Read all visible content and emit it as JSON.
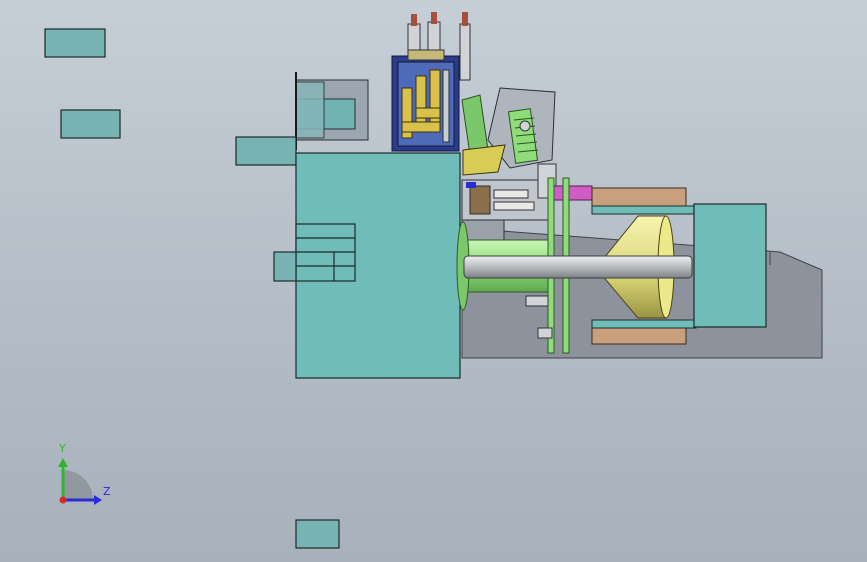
{
  "triad": {
    "y_label": "Y",
    "z_label": "Z",
    "y_color": "#2fb52f",
    "z_color": "#2a2ad6",
    "x_color": "#d62a2a"
  },
  "colors": {
    "background": "#b9c2cb",
    "teal": "#6fbcb8",
    "green": "#8fdc7a",
    "tan": "#c9a07e",
    "yellow": "#ece98a",
    "navy": "#2b3a8c",
    "gray_base": "#8d929c"
  }
}
